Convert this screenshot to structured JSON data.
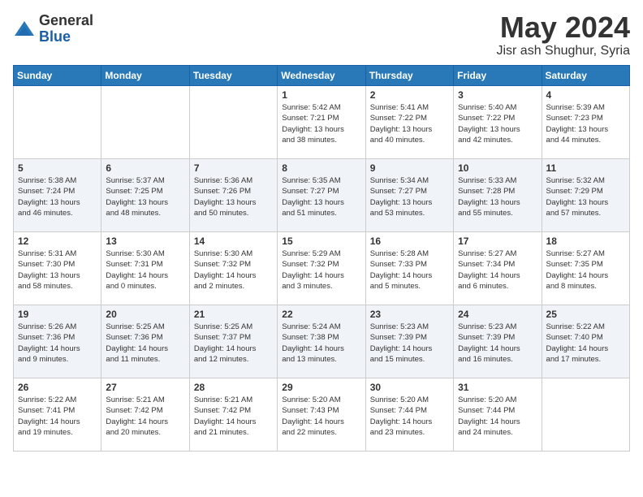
{
  "header": {
    "logo_line1": "General",
    "logo_line2": "Blue",
    "month_title": "May 2024",
    "location": "Jisr ash Shughur, Syria"
  },
  "weekdays": [
    "Sunday",
    "Monday",
    "Tuesday",
    "Wednesday",
    "Thursday",
    "Friday",
    "Saturday"
  ],
  "weeks": [
    [
      {
        "day": "",
        "info": ""
      },
      {
        "day": "",
        "info": ""
      },
      {
        "day": "",
        "info": ""
      },
      {
        "day": "1",
        "info": "Sunrise: 5:42 AM\nSunset: 7:21 PM\nDaylight: 13 hours\nand 38 minutes."
      },
      {
        "day": "2",
        "info": "Sunrise: 5:41 AM\nSunset: 7:22 PM\nDaylight: 13 hours\nand 40 minutes."
      },
      {
        "day": "3",
        "info": "Sunrise: 5:40 AM\nSunset: 7:22 PM\nDaylight: 13 hours\nand 42 minutes."
      },
      {
        "day": "4",
        "info": "Sunrise: 5:39 AM\nSunset: 7:23 PM\nDaylight: 13 hours\nand 44 minutes."
      }
    ],
    [
      {
        "day": "5",
        "info": "Sunrise: 5:38 AM\nSunset: 7:24 PM\nDaylight: 13 hours\nand 46 minutes."
      },
      {
        "day": "6",
        "info": "Sunrise: 5:37 AM\nSunset: 7:25 PM\nDaylight: 13 hours\nand 48 minutes."
      },
      {
        "day": "7",
        "info": "Sunrise: 5:36 AM\nSunset: 7:26 PM\nDaylight: 13 hours\nand 50 minutes."
      },
      {
        "day": "8",
        "info": "Sunrise: 5:35 AM\nSunset: 7:27 PM\nDaylight: 13 hours\nand 51 minutes."
      },
      {
        "day": "9",
        "info": "Sunrise: 5:34 AM\nSunset: 7:27 PM\nDaylight: 13 hours\nand 53 minutes."
      },
      {
        "day": "10",
        "info": "Sunrise: 5:33 AM\nSunset: 7:28 PM\nDaylight: 13 hours\nand 55 minutes."
      },
      {
        "day": "11",
        "info": "Sunrise: 5:32 AM\nSunset: 7:29 PM\nDaylight: 13 hours\nand 57 minutes."
      }
    ],
    [
      {
        "day": "12",
        "info": "Sunrise: 5:31 AM\nSunset: 7:30 PM\nDaylight: 13 hours\nand 58 minutes."
      },
      {
        "day": "13",
        "info": "Sunrise: 5:30 AM\nSunset: 7:31 PM\nDaylight: 14 hours\nand 0 minutes."
      },
      {
        "day": "14",
        "info": "Sunrise: 5:30 AM\nSunset: 7:32 PM\nDaylight: 14 hours\nand 2 minutes."
      },
      {
        "day": "15",
        "info": "Sunrise: 5:29 AM\nSunset: 7:32 PM\nDaylight: 14 hours\nand 3 minutes."
      },
      {
        "day": "16",
        "info": "Sunrise: 5:28 AM\nSunset: 7:33 PM\nDaylight: 14 hours\nand 5 minutes."
      },
      {
        "day": "17",
        "info": "Sunrise: 5:27 AM\nSunset: 7:34 PM\nDaylight: 14 hours\nand 6 minutes."
      },
      {
        "day": "18",
        "info": "Sunrise: 5:27 AM\nSunset: 7:35 PM\nDaylight: 14 hours\nand 8 minutes."
      }
    ],
    [
      {
        "day": "19",
        "info": "Sunrise: 5:26 AM\nSunset: 7:36 PM\nDaylight: 14 hours\nand 9 minutes."
      },
      {
        "day": "20",
        "info": "Sunrise: 5:25 AM\nSunset: 7:36 PM\nDaylight: 14 hours\nand 11 minutes."
      },
      {
        "day": "21",
        "info": "Sunrise: 5:25 AM\nSunset: 7:37 PM\nDaylight: 14 hours\nand 12 minutes."
      },
      {
        "day": "22",
        "info": "Sunrise: 5:24 AM\nSunset: 7:38 PM\nDaylight: 14 hours\nand 13 minutes."
      },
      {
        "day": "23",
        "info": "Sunrise: 5:23 AM\nSunset: 7:39 PM\nDaylight: 14 hours\nand 15 minutes."
      },
      {
        "day": "24",
        "info": "Sunrise: 5:23 AM\nSunset: 7:39 PM\nDaylight: 14 hours\nand 16 minutes."
      },
      {
        "day": "25",
        "info": "Sunrise: 5:22 AM\nSunset: 7:40 PM\nDaylight: 14 hours\nand 17 minutes."
      }
    ],
    [
      {
        "day": "26",
        "info": "Sunrise: 5:22 AM\nSunset: 7:41 PM\nDaylight: 14 hours\nand 19 minutes."
      },
      {
        "day": "27",
        "info": "Sunrise: 5:21 AM\nSunset: 7:42 PM\nDaylight: 14 hours\nand 20 minutes."
      },
      {
        "day": "28",
        "info": "Sunrise: 5:21 AM\nSunset: 7:42 PM\nDaylight: 14 hours\nand 21 minutes."
      },
      {
        "day": "29",
        "info": "Sunrise: 5:20 AM\nSunset: 7:43 PM\nDaylight: 14 hours\nand 22 minutes."
      },
      {
        "day": "30",
        "info": "Sunrise: 5:20 AM\nSunset: 7:44 PM\nDaylight: 14 hours\nand 23 minutes."
      },
      {
        "day": "31",
        "info": "Sunrise: 5:20 AM\nSunset: 7:44 PM\nDaylight: 14 hours\nand 24 minutes."
      },
      {
        "day": "",
        "info": ""
      }
    ]
  ]
}
